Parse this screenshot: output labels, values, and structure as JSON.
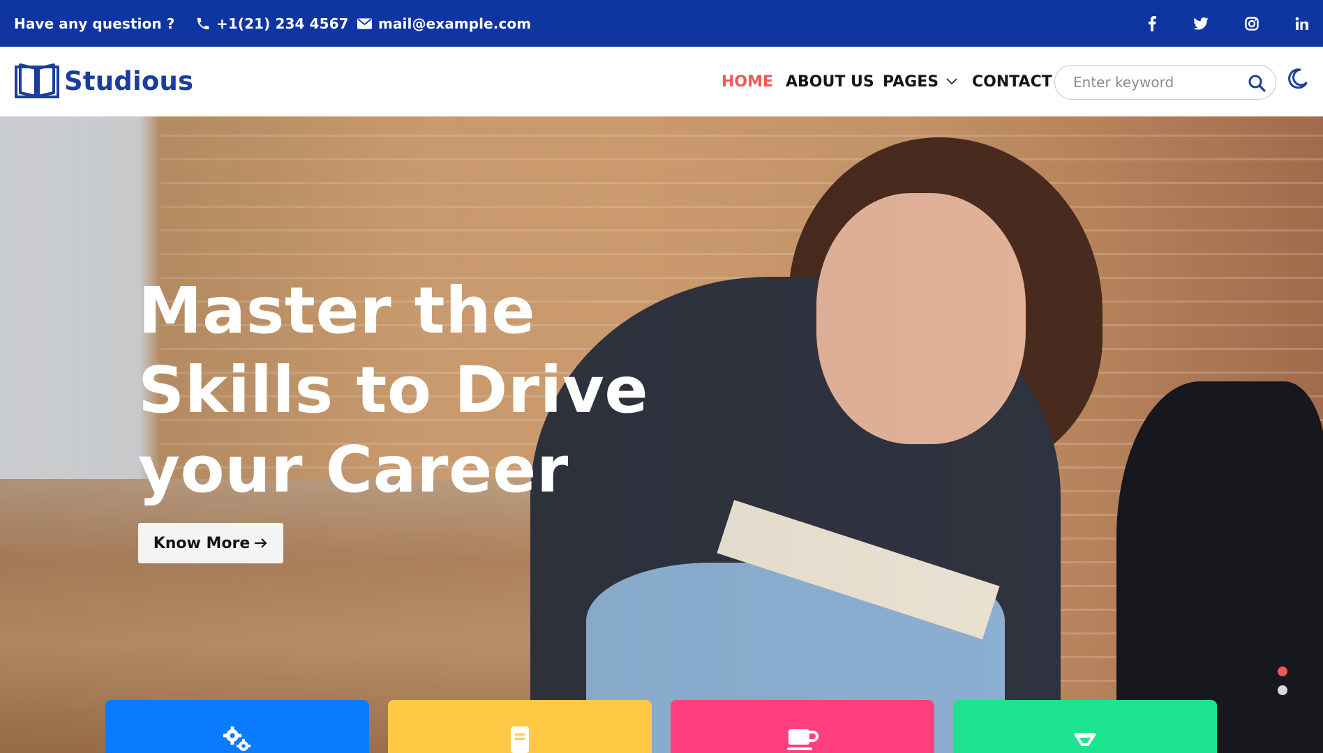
{
  "topbar": {
    "question": "Have any question ?",
    "phone": "+1(21) 234 4567",
    "email": "mail@example.com",
    "socials": [
      "facebook-icon",
      "twitter-icon",
      "instagram-icon",
      "linkedin-icon"
    ]
  },
  "header": {
    "logo_text": "Studious",
    "nav": {
      "home": "HOME",
      "about": "ABOUT US",
      "pages": "PAGES",
      "contact": "CONTACT"
    },
    "search_placeholder": "Enter keyword"
  },
  "hero": {
    "title_line1": "Master the",
    "title_line2": "Skills to Drive",
    "title_line3": "your Career",
    "button_label": "Know More",
    "slider_dots": 2,
    "active_dot": 1
  },
  "cards": [
    {
      "icon": "gears-icon",
      "color": "#0a7bff"
    },
    {
      "icon": "book-icon",
      "color": "#ffc845"
    },
    {
      "icon": "coffee-cup-icon",
      "color": "#ff3f7e"
    },
    {
      "icon": "hourglass-icon",
      "color": "#1be38f"
    }
  ],
  "colors": {
    "topbar": "#0f35a1",
    "brand": "#1a3d9e",
    "nav_active": "#f25757",
    "dot_active": "#f25757",
    "dot_inactive": "#d9d9d9"
  }
}
